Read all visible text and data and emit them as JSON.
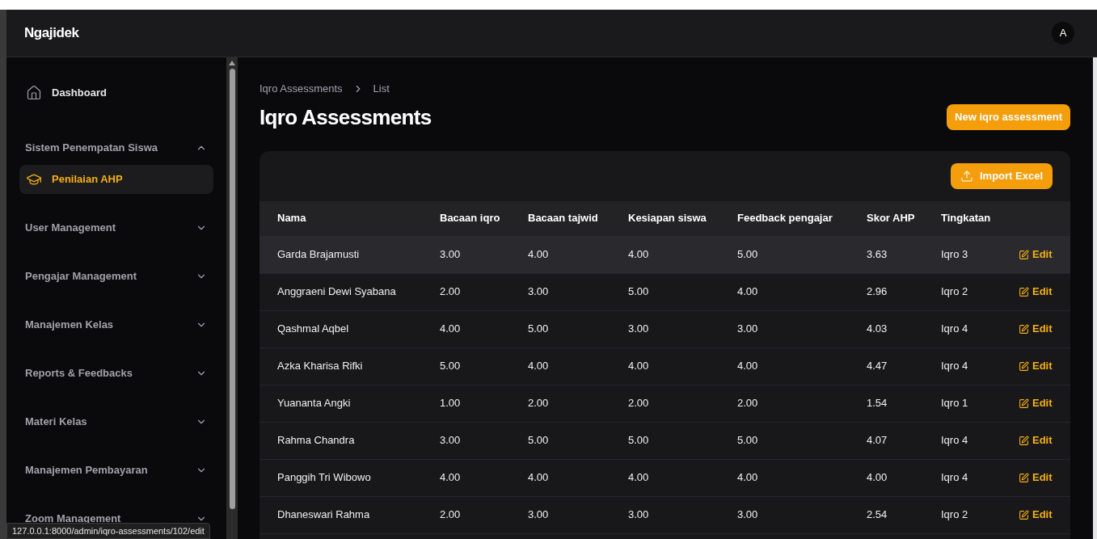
{
  "header": {
    "brand": "Ngajidek",
    "avatar": "A"
  },
  "sidebar": {
    "items": [
      {
        "kind": "link",
        "label": "Dashboard",
        "selected": false
      },
      {
        "kind": "group",
        "label": "Sistem Penempatan Siswa",
        "expanded": true,
        "children": [
          {
            "label": "Penilaian AHP",
            "selected": true
          }
        ]
      },
      {
        "kind": "group",
        "label": "User Management",
        "expanded": false
      },
      {
        "kind": "group",
        "label": "Pengajar Management",
        "expanded": false
      },
      {
        "kind": "group",
        "label": "Manajemen Kelas",
        "expanded": false
      },
      {
        "kind": "group",
        "label": "Reports & Feedbacks",
        "expanded": false
      },
      {
        "kind": "group",
        "label": "Materi Kelas",
        "expanded": false
      },
      {
        "kind": "group",
        "label": "Manajemen Pembayaran",
        "expanded": false
      },
      {
        "kind": "group",
        "label": "Zoom Management",
        "expanded": false
      }
    ]
  },
  "breadcrumb": [
    "Iqro Assessments",
    "List"
  ],
  "page_title": "Iqro Assessments",
  "new_button": "New iqro assessment",
  "import_button": "Import Excel",
  "table": {
    "columns": [
      "Nama",
      "Bacaan iqro",
      "Bacaan tajwid",
      "Kesiapan siswa",
      "Feedback pengajar",
      "Skor AHP",
      "Tingkatan"
    ],
    "rows": [
      {
        "cells": [
          "Garda Brajamusti",
          "3.00",
          "4.00",
          "4.00",
          "5.00",
          "3.63",
          "Iqro 3"
        ],
        "action": "Edit",
        "hovered": true
      },
      {
        "cells": [
          "Anggraeni Dewi Syabana",
          "2.00",
          "3.00",
          "5.00",
          "4.00",
          "2.96",
          "Iqro 2"
        ],
        "action": "Edit",
        "hovered": false
      },
      {
        "cells": [
          "Qashmal Aqbel",
          "4.00",
          "5.00",
          "3.00",
          "3.00",
          "4.03",
          "Iqro 4"
        ],
        "action": "Edit",
        "hovered": false
      },
      {
        "cells": [
          "Azka Kharisa Rifki",
          "5.00",
          "4.00",
          "4.00",
          "4.00",
          "4.47",
          "Iqro 4"
        ],
        "action": "Edit",
        "hovered": false
      },
      {
        "cells": [
          "Yuananta Angki",
          "1.00",
          "2.00",
          "2.00",
          "2.00",
          "1.54",
          "Iqro 1"
        ],
        "action": "Edit",
        "hovered": false
      },
      {
        "cells": [
          "Rahma Chandra",
          "3.00",
          "5.00",
          "5.00",
          "5.00",
          "4.07",
          "Iqro 4"
        ],
        "action": "Edit",
        "hovered": false
      },
      {
        "cells": [
          "Panggih Tri Wibowo",
          "4.00",
          "4.00",
          "4.00",
          "4.00",
          "4.00",
          "Iqro 4"
        ],
        "action": "Edit",
        "hovered": false
      },
      {
        "cells": [
          "Dhaneswari Rahma",
          "2.00",
          "3.00",
          "3.00",
          "3.00",
          "2.54",
          "Iqro 2"
        ],
        "action": "Edit",
        "hovered": false
      }
    ]
  },
  "status_url": "127.0.0.1:8000/admin/iqro-assessments/102/edit"
}
